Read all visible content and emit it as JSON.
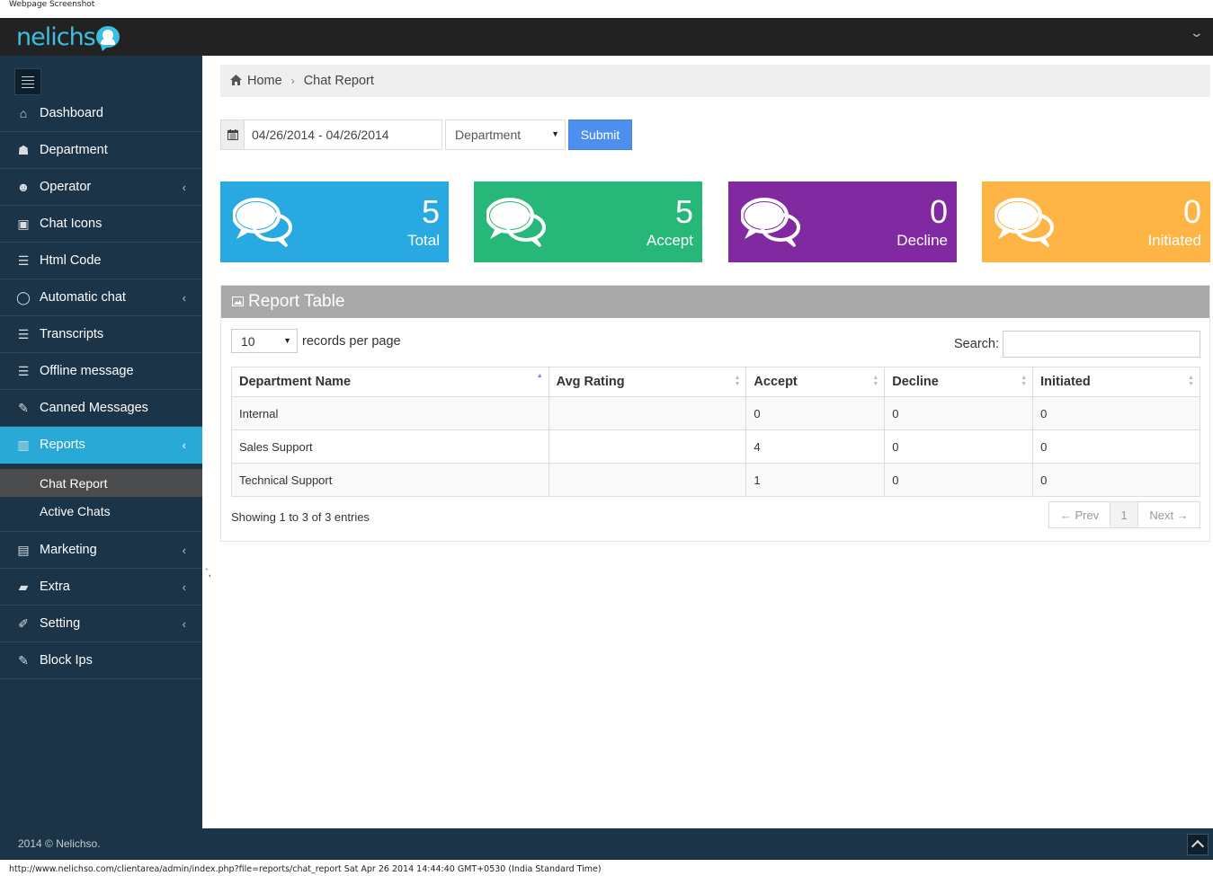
{
  "caption": {
    "top": "Webpage Screenshot",
    "status": "http://www.nelichso.com/clientarea/admin/index.php?file=reports/chat_report Sat Apr 26 2014 14:44:40 GMT+0530 (India Standard Time)"
  },
  "brand": {
    "name": "nelichs"
  },
  "sidebar": {
    "items": [
      {
        "label": "Dashboard",
        "icon": "home-icon",
        "glyph": "⌂"
      },
      {
        "label": "Department",
        "icon": "users-icon",
        "glyph": "☗"
      },
      {
        "label": "Operator",
        "icon": "user-icon",
        "glyph": "☻",
        "caret": "‹"
      },
      {
        "label": "Chat Icons",
        "icon": "image-icon",
        "glyph": "▣"
      },
      {
        "label": "Html Code",
        "icon": "list-icon",
        "glyph": "☰"
      },
      {
        "label": "Automatic chat",
        "icon": "comment-icon",
        "glyph": "◯",
        "caret": "‹"
      },
      {
        "label": "Transcripts",
        "icon": "list-icon",
        "glyph": "☰"
      },
      {
        "label": "Offline message",
        "icon": "list-icon",
        "glyph": "☰"
      },
      {
        "label": "Canned Messages",
        "icon": "pencil-icon",
        "glyph": "✎"
      },
      {
        "label": "Reports",
        "icon": "bar-chart-icon",
        "glyph": "▥",
        "caret": "‹"
      }
    ],
    "submenu": [
      {
        "label": "Chat Report"
      },
      {
        "label": "Active Chats"
      }
    ],
    "items_after": [
      {
        "label": "Marketing",
        "icon": "credit-card-icon",
        "glyph": "▤",
        "caret": "‹"
      },
      {
        "label": "Extra",
        "icon": "briefcase-icon",
        "glyph": "▰",
        "caret": "‹"
      },
      {
        "label": "Setting",
        "icon": "wrench-icon",
        "glyph": "✐",
        "caret": "‹"
      },
      {
        "label": "Block Ips",
        "icon": "pencil-icon",
        "glyph": "✎"
      }
    ]
  },
  "breadcrumb": {
    "home": "Home",
    "sep": "›",
    "current": "Chat Report"
  },
  "filter": {
    "date_range": "04/26/2014 - 04/26/2014",
    "department": "Department",
    "submit": "Submit"
  },
  "stats": [
    {
      "value": "5",
      "label": "Total",
      "color": "#29a9e1"
    },
    {
      "value": "5",
      "label": "Accept",
      "color": "#27b779"
    },
    {
      "value": "0",
      "label": "Decline",
      "color": "#8129a0"
    },
    {
      "value": "0",
      "label": "Initiated",
      "color": "#ffb546"
    }
  ],
  "report": {
    "title": "Report Table",
    "length_value": "10",
    "length_label": "records per page",
    "search_label": "Search:",
    "columns": [
      "Department Name",
      "Avg Rating",
      "Accept",
      "Decline",
      "Initiated"
    ],
    "rows": [
      [
        "Internal",
        "",
        "0",
        "0",
        "0"
      ],
      [
        "Sales Support",
        "",
        "4",
        "0",
        "0"
      ],
      [
        "Technical Support",
        "",
        "1",
        "0",
        "0"
      ]
    ],
    "info": "Showing 1 to 3 of 3 entries",
    "prev": "← Prev",
    "page": "1",
    "next": "Next →"
  },
  "stray_mark": "`,",
  "footer": {
    "text": "2014 © Nelichso."
  }
}
